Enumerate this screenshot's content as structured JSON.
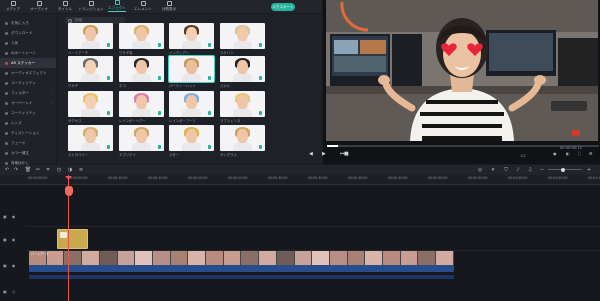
{
  "toolbar": {
    "tabs": [
      {
        "label": "メディア"
      },
      {
        "label": "オーディオ"
      },
      {
        "label": "タイトル"
      },
      {
        "label": "トランジション"
      },
      {
        "label": "エフェクト"
      },
      {
        "label": "エレメント"
      },
      {
        "label": "分割表示"
      }
    ],
    "active_tab": "エフェクト",
    "export_label": "エクスポート"
  },
  "sidebar": {
    "items": [
      {
        "label": "お気に入り"
      },
      {
        "label": "ダウンロード"
      },
      {
        "label": "人気"
      },
      {
        "label": "AIポートレート"
      },
      {
        "label": "AR ステッカー"
      },
      {
        "label": "オーディオエフェクト"
      },
      {
        "label": "ユーティリティ"
      },
      {
        "label": "フィルター"
      },
      {
        "label": "オーバーレイ"
      },
      {
        "label": "ユーティリティ"
      },
      {
        "label": "レンズ"
      },
      {
        "label": "ディストーション"
      },
      {
        "label": "フェード"
      },
      {
        "label": "カラー補正"
      },
      {
        "label": "背景ぼかし"
      }
    ]
  },
  "library": {
    "search_placeholder": "検索",
    "items": [
      {
        "label": "ハートアーチ"
      },
      {
        "label": "ウサギ耳"
      },
      {
        "label": "インディアン"
      },
      {
        "label": "スケバン"
      },
      {
        "label": "ウサギ"
      },
      {
        "label": "ネコ"
      },
      {
        "label": "パーティーハット"
      },
      {
        "label": "スカル"
      },
      {
        "label": "サクセス"
      },
      {
        "label": "レインボーヘアー"
      },
      {
        "label": "レインボーフード"
      },
      {
        "label": "ラブジェンヌ"
      },
      {
        "label": "ストロベリー"
      },
      {
        "label": "エブリデイ"
      },
      {
        "label": "スター"
      },
      {
        "label": "サングラス"
      }
    ]
  },
  "preview": {
    "timecode": "00:00:00:12",
    "ratio": "1/2",
    "progress": 0.04
  },
  "ruler": {
    "ticks": [
      "00:00:00:00",
      "00:00:05:00",
      "00:00:10:00",
      "00:00:15:00",
      "00:00:20:00",
      "00:00:25:00",
      "00:00:30:00",
      "00:00:35:00",
      "00:00:40:00",
      "00:00:45:00",
      "00:00:50:00",
      "00:00:55:00",
      "00:01:00:00",
      "00:01:05:00",
      "00:01:10:00"
    ]
  },
  "tracks": {
    "video_clip_label": "ハートアーチ"
  },
  "colors": {
    "accent": "#3fd1bf",
    "playhead": "#e8554e",
    "sticker_clip": "#c9a84e",
    "audio": "#274d8c"
  }
}
